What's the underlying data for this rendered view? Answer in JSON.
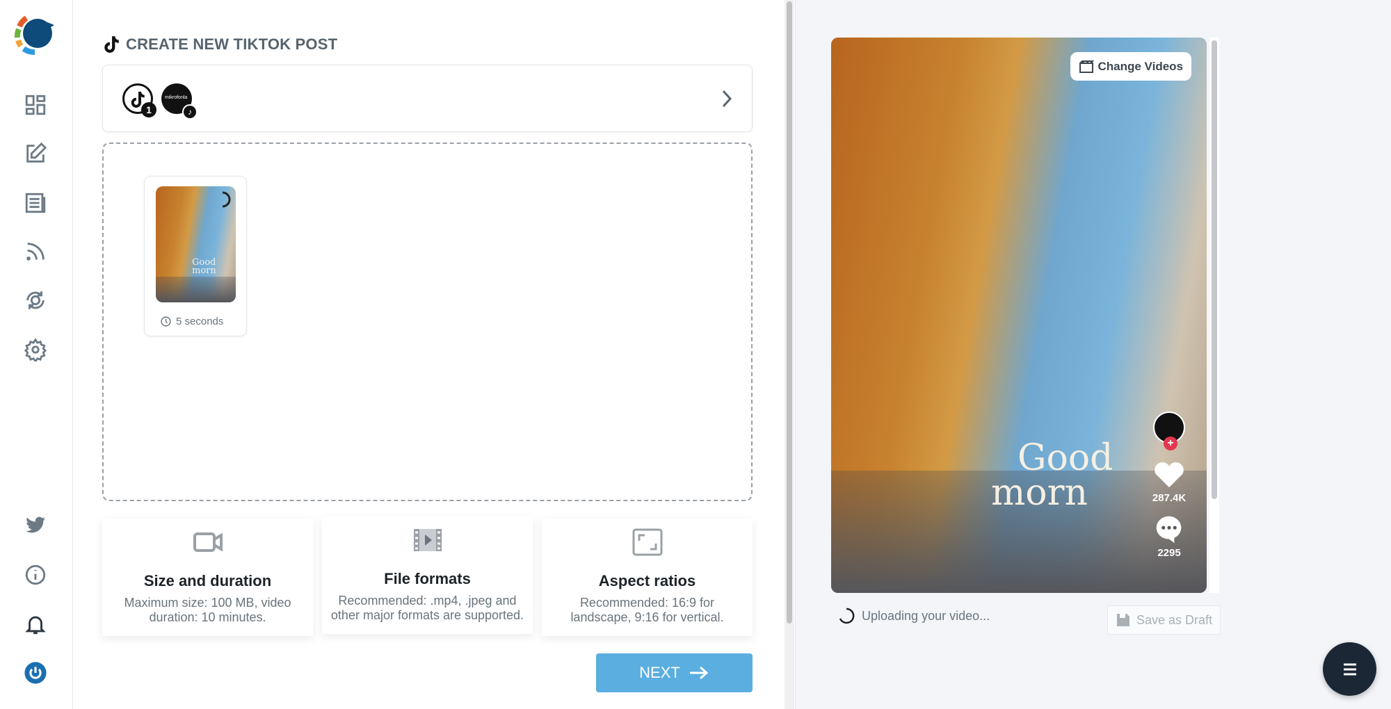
{
  "page": {
    "title": "CREATE NEW TIKTOK POST"
  },
  "accounts": {
    "selected_count": "1",
    "account_name": "mikrofonla"
  },
  "upload": {
    "thumbnail_text": "Good morn",
    "duration": "5 seconds"
  },
  "info_cards": [
    {
      "icon": "video-camera-icon",
      "title": "Size and duration",
      "text": "Maximum size: 100 MB, video duration: 10 minutes."
    },
    {
      "icon": "film-icon",
      "title": "File formats",
      "text": "Recommended: .mp4, .jpeg and other major formats are supported."
    },
    {
      "icon": "aspect-ratio-icon",
      "title": "Aspect ratios",
      "text": "Recommended: 16:9 for landscape, 9:16 for vertical."
    }
  ],
  "next_label": "NEXT",
  "preview": {
    "change_videos": "Change Videos",
    "overlay_line1": "Good",
    "overlay_line2": "morn",
    "likes": "287.4K",
    "comments": "2295",
    "status": "Uploading your video...",
    "save_draft": "Save as Draft"
  },
  "colors": {
    "accent": "#5aaee0",
    "fab": "#1b2735",
    "brand": "#0e4a7a"
  }
}
